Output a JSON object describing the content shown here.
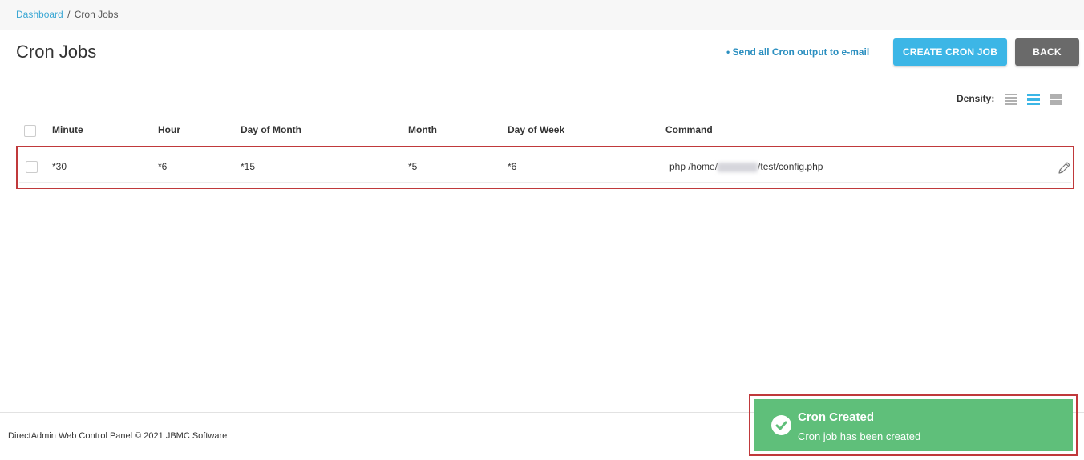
{
  "breadcrumb": {
    "home": "Dashboard",
    "separator": "/",
    "current": "Cron Jobs"
  },
  "page": {
    "title": "Cron Jobs"
  },
  "actions": {
    "email_link": "• Send all Cron output to e-mail",
    "create_button": "CREATE CRON JOB",
    "back_button": "BACK"
  },
  "density": {
    "label": "Density:",
    "selected": "medium"
  },
  "table": {
    "columns": [
      "Minute",
      "Hour",
      "Day of Month",
      "Month",
      "Day of Week",
      "Command"
    ],
    "rows": [
      {
        "minute": "*30",
        "hour": "*6",
        "day_of_month": "*15",
        "month": "*5",
        "day_of_week": "*6",
        "command_prefix": "php /home/",
        "command_suffix": "/test/config.php"
      }
    ]
  },
  "footer": {
    "text": "DirectAdmin Web Control Panel © 2021 JBMC Software"
  },
  "toast": {
    "title": "Cron Created",
    "message": "Cron job has been created"
  },
  "colors": {
    "accent": "#3cb6e6",
    "link": "#2b8fc0",
    "success": "#5fbf7a",
    "highlight": "#c0393b",
    "back": "#6a6a6a"
  }
}
